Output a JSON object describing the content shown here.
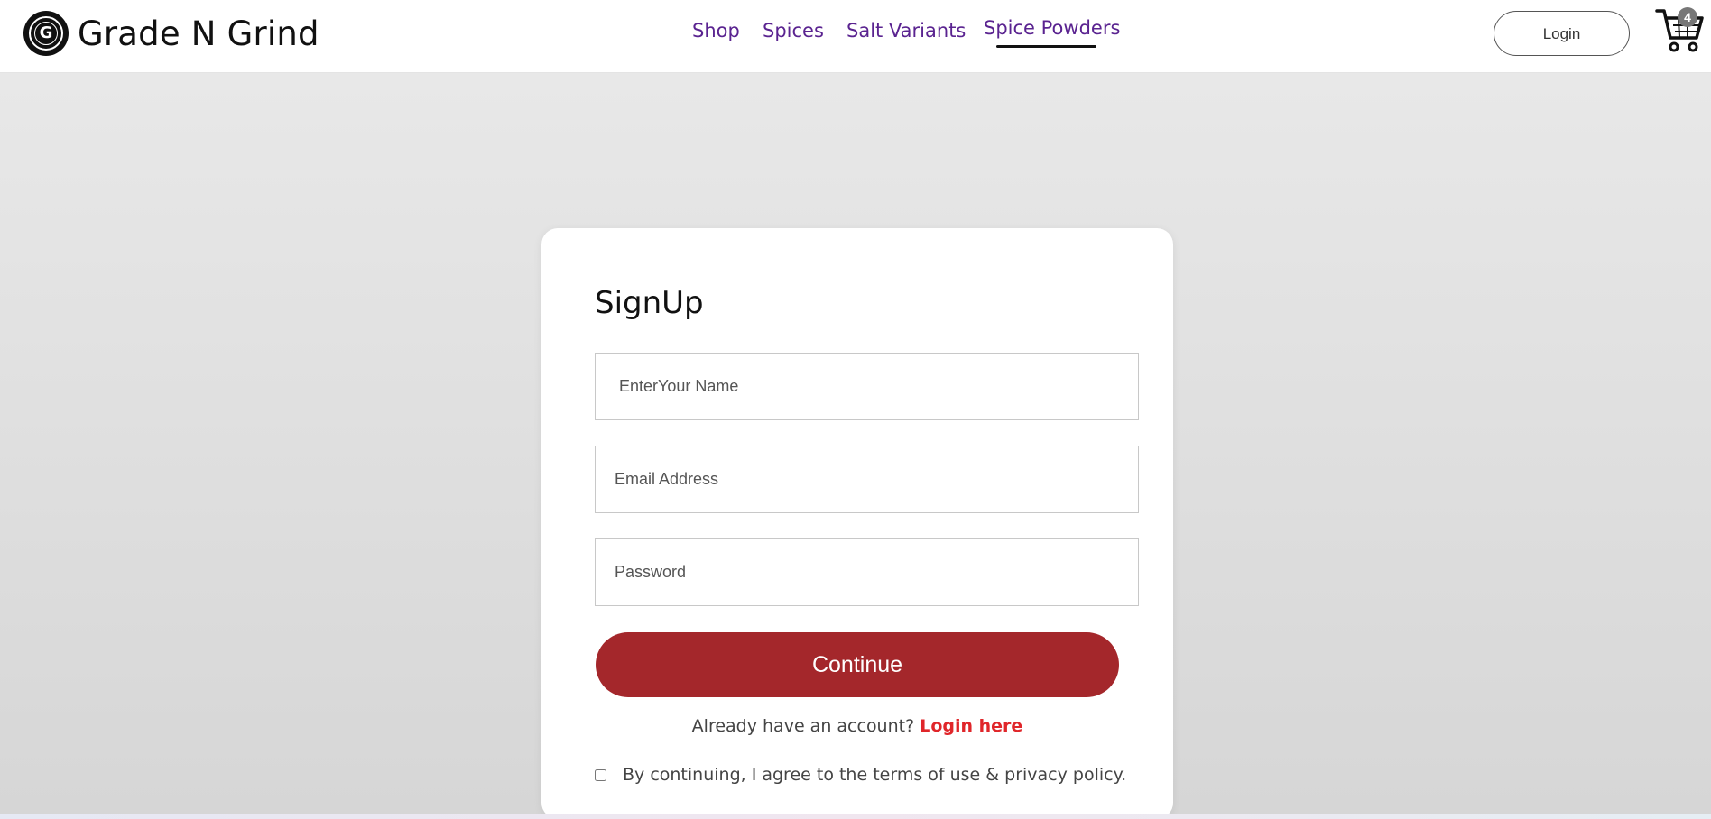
{
  "brand": {
    "name": "Grade N Grind",
    "logo_letter": "G",
    "logo_icon": "grade-n-grind-logo"
  },
  "nav": {
    "links": [
      "Shop",
      "Spices",
      "Salt Variants",
      "Spice Powders"
    ],
    "active_link": "Spice Powders"
  },
  "header": {
    "login_label": "Login",
    "cart_icon": "shopping-cart-icon",
    "cart_count": "4"
  },
  "signup": {
    "title": "SignUp",
    "name_placeholder": "EnterYour Name",
    "email_placeholder": "Email Address",
    "password_placeholder": "Password",
    "continue_label": "Continue",
    "account_prompt": "Already have an account?",
    "login_link": "Login here",
    "terms_text": "By continuing, I agree to the terms of use & privacy policy.",
    "terms_checked": false
  },
  "colors": {
    "nav_link": "#5a2390",
    "continue_button": "#a4272b",
    "login_link": "#e0262a"
  }
}
